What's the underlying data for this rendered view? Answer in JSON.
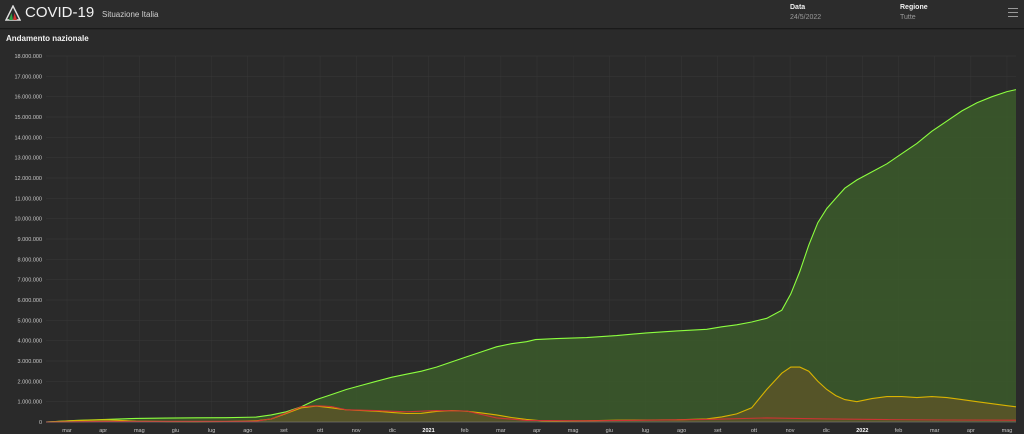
{
  "header": {
    "title": "COVID-19",
    "subtitle": "Situazione Italia",
    "date_label": "Data",
    "date_value": "24/5/2022",
    "region_label": "Regione",
    "region_value": "Tutte",
    "menu_icon": "hamburger-menu-icon",
    "logo_icon": "italy-flag-logo-icon"
  },
  "panel": {
    "title": "Andamento nazionale"
  },
  "colors": {
    "background": "#2a2a2a",
    "green": "#8cff3f",
    "yellow": "#d9b300",
    "red": "#cc3333",
    "grid": "#3a3a3a"
  },
  "chart_data": {
    "type": "area",
    "y_ticks": [
      "0",
      "1.000.000",
      "2.000.000",
      "3.000.000",
      "4.000.000",
      "5.000.000",
      "6.000.000",
      "7.000.000",
      "8.000.000",
      "9.000.000",
      "10.000.000",
      "11.000.000",
      "12.000.000",
      "13.000.000",
      "14.000.000",
      "15.000.000",
      "16.000.000",
      "17.000.000",
      "18.000.000"
    ],
    "ylim": [
      0,
      18000000
    ],
    "x_ticks": [
      {
        "label": "mar",
        "bold": false
      },
      {
        "label": "apr",
        "bold": false
      },
      {
        "label": "mag",
        "bold": false
      },
      {
        "label": "giu",
        "bold": false
      },
      {
        "label": "lug",
        "bold": false
      },
      {
        "label": "ago",
        "bold": false
      },
      {
        "label": "set",
        "bold": false
      },
      {
        "label": "ott",
        "bold": false
      },
      {
        "label": "nov",
        "bold": false
      },
      {
        "label": "dic",
        "bold": false
      },
      {
        "label": "2021",
        "bold": true
      },
      {
        "label": "feb",
        "bold": false
      },
      {
        "label": "mar",
        "bold": false
      },
      {
        "label": "apr",
        "bold": false
      },
      {
        "label": "mag",
        "bold": false
      },
      {
        "label": "giu",
        "bold": false
      },
      {
        "label": "lug",
        "bold": false
      },
      {
        "label": "ago",
        "bold": false
      },
      {
        "label": "set",
        "bold": false
      },
      {
        "label": "ott",
        "bold": false
      },
      {
        "label": "nov",
        "bold": false
      },
      {
        "label": "dic",
        "bold": false
      },
      {
        "label": "2022",
        "bold": true
      },
      {
        "label": "feb",
        "bold": false
      },
      {
        "label": "mar",
        "bold": false
      },
      {
        "label": "apr",
        "bold": false
      },
      {
        "label": "mag",
        "bold": false
      }
    ],
    "x_months": [
      0,
      27.1
    ],
    "series": [
      {
        "color": "#8cff3f",
        "fill": "#3b5a2a",
        "points": [
          [
            0,
            0
          ],
          [
            1,
            80000
          ],
          [
            2,
            130000
          ],
          [
            3,
            175000
          ],
          [
            4,
            190000
          ],
          [
            5,
            205000
          ],
          [
            6,
            210000
          ],
          [
            7,
            240000
          ],
          [
            7.5,
            350000
          ],
          [
            8,
            500000
          ],
          [
            8.5,
            750000
          ],
          [
            9,
            1100000
          ],
          [
            9.5,
            1350000
          ],
          [
            10,
            1600000
          ],
          [
            10.5,
            1800000
          ],
          [
            11,
            2000000
          ],
          [
            11.5,
            2200000
          ],
          [
            12,
            2350000
          ],
          [
            12.5,
            2500000
          ],
          [
            13,
            2700000
          ],
          [
            13.5,
            2950000
          ],
          [
            14,
            3200000
          ],
          [
            14.5,
            3450000
          ],
          [
            15,
            3700000
          ],
          [
            15.5,
            3850000
          ],
          [
            16,
            3950000
          ],
          [
            16.3,
            4050000
          ],
          [
            17,
            4100000
          ],
          [
            18,
            4150000
          ],
          [
            19,
            4250000
          ],
          [
            20,
            4380000
          ],
          [
            21,
            4480000
          ],
          [
            22,
            4560000
          ],
          [
            22.5,
            4680000
          ],
          [
            23,
            4780000
          ],
          [
            23.5,
            4920000
          ],
          [
            24,
            5100000
          ],
          [
            24.5,
            5500000
          ],
          [
            24.8,
            6300000
          ],
          [
            25.1,
            7400000
          ],
          [
            25.4,
            8700000
          ],
          [
            25.7,
            9800000
          ],
          [
            26,
            10500000
          ],
          [
            26.3,
            11000000
          ],
          [
            26.6,
            11500000
          ],
          [
            27,
            11900000
          ],
          [
            27.5,
            12300000
          ],
          [
            28,
            12700000
          ],
          [
            28.5,
            13200000
          ],
          [
            29,
            13700000
          ],
          [
            29.5,
            14300000
          ],
          [
            30,
            14800000
          ],
          [
            30.5,
            15300000
          ],
          [
            31,
            15700000
          ],
          [
            31.5,
            16000000
          ],
          [
            32,
            16250000
          ],
          [
            32.3,
            16350000
          ]
        ]
      },
      {
        "color": "#d9b300",
        "fill": "#5a5528",
        "points": [
          [
            0,
            0
          ],
          [
            1,
            70000
          ],
          [
            2,
            110000
          ],
          [
            3,
            40000
          ],
          [
            4,
            20000
          ],
          [
            5,
            15000
          ],
          [
            6,
            25000
          ],
          [
            7,
            60000
          ],
          [
            7.5,
            150000
          ],
          [
            8,
            420000
          ],
          [
            8.5,
            700000
          ],
          [
            9,
            780000
          ],
          [
            9.5,
            700000
          ],
          [
            10,
            600000
          ],
          [
            11,
            530000
          ],
          [
            11.5,
            470000
          ],
          [
            12,
            420000
          ],
          [
            12.5,
            430000
          ],
          [
            13,
            520000
          ],
          [
            13.5,
            560000
          ],
          [
            14,
            530000
          ],
          [
            14.5,
            450000
          ],
          [
            15,
            350000
          ],
          [
            15.5,
            220000
          ],
          [
            16,
            130000
          ],
          [
            16.5,
            60000
          ],
          [
            17,
            45000
          ],
          [
            18,
            60000
          ],
          [
            19,
            90000
          ],
          [
            20,
            100000
          ],
          [
            21,
            110000
          ],
          [
            22,
            150000
          ],
          [
            22.5,
            250000
          ],
          [
            23,
            400000
          ],
          [
            23.5,
            700000
          ],
          [
            24,
            1600000
          ],
          [
            24.5,
            2400000
          ],
          [
            24.8,
            2700000
          ],
          [
            25.1,
            2700000
          ],
          [
            25.4,
            2500000
          ],
          [
            25.7,
            2000000
          ],
          [
            26,
            1600000
          ],
          [
            26.3,
            1300000
          ],
          [
            26.6,
            1100000
          ],
          [
            27,
            1000000
          ],
          [
            27.5,
            1150000
          ],
          [
            28,
            1250000
          ],
          [
            28.5,
            1250000
          ],
          [
            29,
            1200000
          ],
          [
            29.5,
            1250000
          ],
          [
            30,
            1200000
          ],
          [
            30.5,
            1100000
          ],
          [
            31,
            1000000
          ],
          [
            31.5,
            900000
          ],
          [
            32,
            800000
          ],
          [
            32.3,
            750000
          ]
        ]
      },
      {
        "color": "#cc3333",
        "fill": "none",
        "points": [
          [
            0,
            0
          ],
          [
            2,
            30000
          ],
          [
            4,
            35000
          ],
          [
            6,
            36000
          ],
          [
            7,
            38000
          ],
          [
            7.5,
            150000
          ],
          [
            8,
            450000
          ],
          [
            8.5,
            750000
          ],
          [
            9,
            800000
          ],
          [
            9.5,
            760000
          ],
          [
            10,
            600000
          ],
          [
            11,
            560000
          ],
          [
            12,
            500000
          ],
          [
            13,
            560000
          ],
          [
            14,
            540000
          ],
          [
            15,
            200000
          ],
          [
            16,
            80000
          ],
          [
            18,
            60000
          ],
          [
            20,
            90000
          ],
          [
            22,
            130000
          ],
          [
            24,
            200000
          ],
          [
            26,
            150000
          ],
          [
            28,
            120000
          ],
          [
            30,
            100000
          ],
          [
            32.3,
            90000
          ]
        ]
      }
    ]
  }
}
